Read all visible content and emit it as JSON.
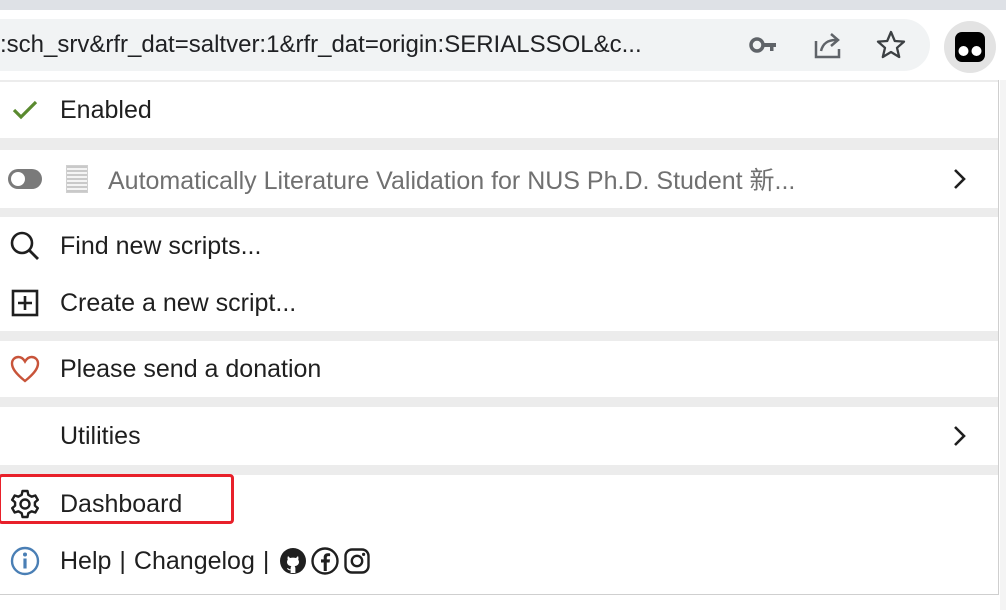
{
  "browser": {
    "url_text": ":sch_srv&rfr_dat=saltver:1&rfr_dat=origin:SERIALSSOL&c...",
    "icons": [
      "key-icon",
      "share-icon",
      "star-icon",
      "tampermonkey-icon"
    ]
  },
  "menu": {
    "enabled_label": "Enabled",
    "script": {
      "name": "Automatically Literature Validation for NUS Ph.D. Student 新..."
    },
    "find_scripts_label": "Find new scripts...",
    "create_script_label": "Create a new script...",
    "donation_label": "Please send a donation",
    "utilities_label": "Utilities",
    "dashboard_label": "Dashboard",
    "help_label": "Help",
    "separator": "|",
    "changelog_label": "Changelog"
  },
  "colors": {
    "check": "#5a8a2f",
    "heart": "#c8543a",
    "info": "#4a7fb5",
    "highlight": "#e8202a"
  }
}
